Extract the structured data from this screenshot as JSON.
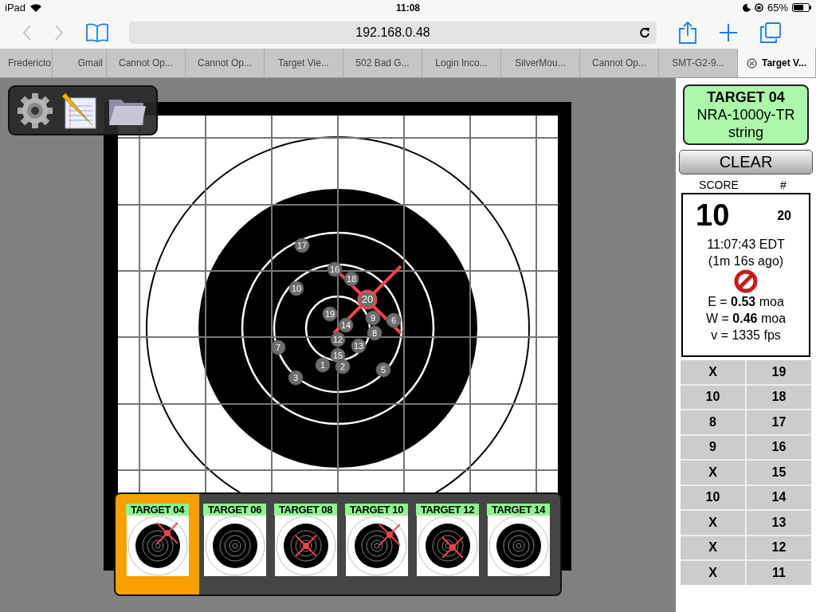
{
  "status_bar": {
    "device": "iPad",
    "time": "11:08",
    "battery": "65%"
  },
  "browser": {
    "url": "192.168.0.48",
    "back_disabled": true,
    "forward_disabled": true
  },
  "tabs": [
    {
      "label": "Fredericto",
      "selected": false
    },
    {
      "label": "Gmail",
      "selected": false
    },
    {
      "label": "Cannot Op...",
      "selected": false
    },
    {
      "label": "Cannot Op...",
      "selected": false
    },
    {
      "label": "Target Vie...",
      "selected": false
    },
    {
      "label": "502 Bad G...",
      "selected": false
    },
    {
      "label": "Login Inco...",
      "selected": false
    },
    {
      "label": "SilverMou...",
      "selected": false
    },
    {
      "label": "Cannot Op...",
      "selected": false
    },
    {
      "label": "SMT-G2-9...",
      "selected": false
    },
    {
      "label": "Target V...",
      "selected": true
    }
  ],
  "shots": [
    {
      "label": "17",
      "selected": false
    },
    {
      "label": "16",
      "selected": false
    },
    {
      "label": "18",
      "selected": false
    },
    {
      "label": "10",
      "selected": false
    },
    {
      "label": "19",
      "selected": false
    },
    {
      "label": "9",
      "selected": false
    },
    {
      "label": "6",
      "selected": false
    },
    {
      "label": "14",
      "selected": false
    },
    {
      "label": "8",
      "selected": false
    },
    {
      "label": "12",
      "selected": false
    },
    {
      "label": "15",
      "selected": false
    },
    {
      "label": "13",
      "selected": false
    },
    {
      "label": "7",
      "selected": false
    },
    {
      "label": "1",
      "selected": false
    },
    {
      "label": "2",
      "selected": false
    },
    {
      "label": "5",
      "selected": false
    },
    {
      "label": "3",
      "selected": false
    },
    {
      "label": "20",
      "selected": true
    }
  ],
  "thumbnails": [
    {
      "label": "TARGET 04",
      "selected": true
    },
    {
      "label": "TARGET 06",
      "selected": false
    },
    {
      "label": "TARGET 08",
      "selected": false
    },
    {
      "label": "TARGET 10",
      "selected": false
    },
    {
      "label": "TARGET 12",
      "selected": false
    },
    {
      "label": "TARGET 14",
      "selected": false
    }
  ],
  "sidebar": {
    "target": "TARGET 04",
    "course": "NRA-1000y-TR",
    "mode": "string",
    "clear_button": "CLEAR",
    "score_heading": "SCORE",
    "number_heading": "#",
    "shot": {
      "score": "10",
      "number": "20",
      "time": "11:07:43 EDT",
      "ago": "(1m 16s ago)",
      "elevation": "E = **0.53** moa",
      "windage": "W = **0.46** moa",
      "velocity": "v = 1335 fps"
    },
    "history": [
      {
        "score": "X",
        "number": "19"
      },
      {
        "score": "10",
        "number": "18"
      },
      {
        "score": "8",
        "number": "17"
      },
      {
        "score": "9",
        "number": "16"
      },
      {
        "score": "X",
        "number": "15"
      },
      {
        "score": "10",
        "number": "14"
      },
      {
        "score": "X",
        "number": "13"
      },
      {
        "score": "X",
        "number": "12"
      },
      {
        "score": "X",
        "number": "11"
      }
    ]
  }
}
